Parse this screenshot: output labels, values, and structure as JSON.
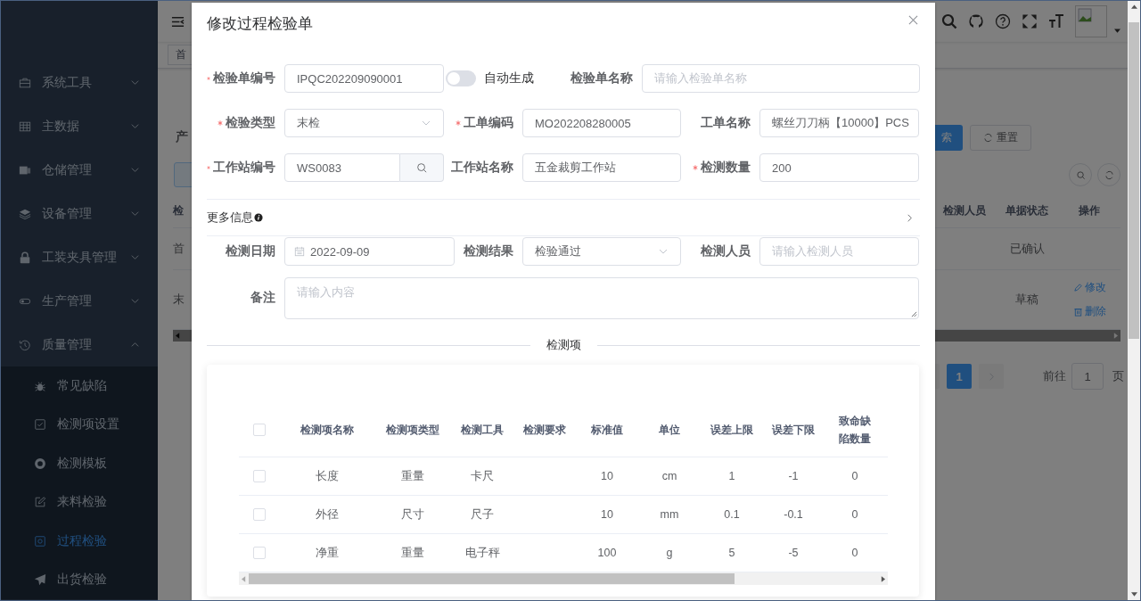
{
  "sidebar": {
    "items": [
      {
        "label": "系统工具",
        "expanded": false
      },
      {
        "label": "主数据",
        "expanded": false
      },
      {
        "label": "仓储管理",
        "expanded": false
      },
      {
        "label": "设备管理",
        "expanded": false
      },
      {
        "label": "工装夹具管理",
        "expanded": false
      },
      {
        "label": "生产管理",
        "expanded": false
      },
      {
        "label": "质量管理",
        "expanded": true,
        "children": [
          {
            "label": "常见缺陷",
            "selected": false
          },
          {
            "label": "检测项设置",
            "selected": false
          },
          {
            "label": "检测模板",
            "selected": false
          },
          {
            "label": "来料检验",
            "selected": false
          },
          {
            "label": "过程检验",
            "selected": true
          },
          {
            "label": "出货检验",
            "selected": false
          }
        ]
      }
    ]
  },
  "tags": [
    "首"
  ],
  "background": {
    "query_label": "产",
    "search_button": "索",
    "reset_button": "重置",
    "table": {
      "columns": [
        "检",
        "检测人员",
        "单据状态",
        "操作"
      ],
      "rows": [
        {
          "column_1": "首",
          "status": "已确认"
        },
        {
          "column_1": "末",
          "status": "草稿",
          "actions": [
            "修改",
            "删除"
          ]
        }
      ]
    },
    "pagination": {
      "pages": [
        {
          "label": "1",
          "selected": true
        }
      ],
      "goto_label": "前往",
      "goto_value": "1",
      "suffix": "页"
    }
  },
  "dialog": {
    "title": "修改过程检验单",
    "rows": [
      [
        {
          "kind": "input",
          "label": "检验单编号",
          "required": true,
          "value": "IPQC202209090001"
        },
        {
          "kind": "switch",
          "label": "自动生成",
          "on": false
        },
        {
          "kind": "input",
          "label": "检验单名称",
          "placeholder": "请输入检验单名称"
        }
      ],
      [
        {
          "kind": "select",
          "label": "检验类型",
          "required": true,
          "value": "末检"
        },
        {
          "kind": "input",
          "label": "工单编码",
          "required": true,
          "value": "MO202208280005"
        },
        {
          "kind": "input",
          "label": "工单名称",
          "value": "螺丝刀刀柄【10000】PCS"
        }
      ],
      [
        {
          "kind": "search",
          "label": "工作站编号",
          "required": true,
          "value": "WS0083"
        },
        {
          "kind": "input",
          "label": "工作站名称",
          "value": "五金裁剪工作站"
        },
        {
          "kind": "input",
          "label": "检测数量",
          "required": true,
          "value": "200"
        }
      ]
    ],
    "more_info": {
      "label": "更多信息",
      "expanded": false
    },
    "more_rows": [
      [
        {
          "kind": "date",
          "label": "检测日期",
          "value": "2022-09-09"
        },
        {
          "kind": "select",
          "label": "检测结果",
          "value": "检验通过"
        },
        {
          "kind": "input",
          "label": "检测人员",
          "placeholder": "请输入检测人员"
        }
      ],
      [
        {
          "kind": "textarea",
          "label": "备注",
          "placeholder": "请输入内容"
        }
      ]
    ],
    "section_title": "检测项",
    "table": {
      "all_checked": false,
      "columns": [
        "检测项名称",
        "检测项类型",
        "检测工具",
        "检测要求",
        "标准值",
        "单位",
        "误差上限",
        "误差下限",
        "致命缺陷数量"
      ],
      "rows": [
        {
          "checked": false,
          "name": "长度",
          "type": "重量",
          "tool": "卡尺",
          "standard": "10",
          "unit": "cm",
          "upper": "1",
          "lower": "-1",
          "fatal": "0"
        },
        {
          "checked": false,
          "name": "外径",
          "type": "尺寸",
          "tool": "尺子",
          "standard": "10",
          "unit": "mm",
          "upper": "0.1",
          "lower": "-0.1",
          "fatal": "0"
        },
        {
          "checked": false,
          "name": "净重",
          "type": "重量",
          "tool": "电子秤",
          "standard": "100",
          "unit": "g",
          "upper": "5",
          "lower": "-5",
          "fatal": "0"
        }
      ]
    }
  }
}
